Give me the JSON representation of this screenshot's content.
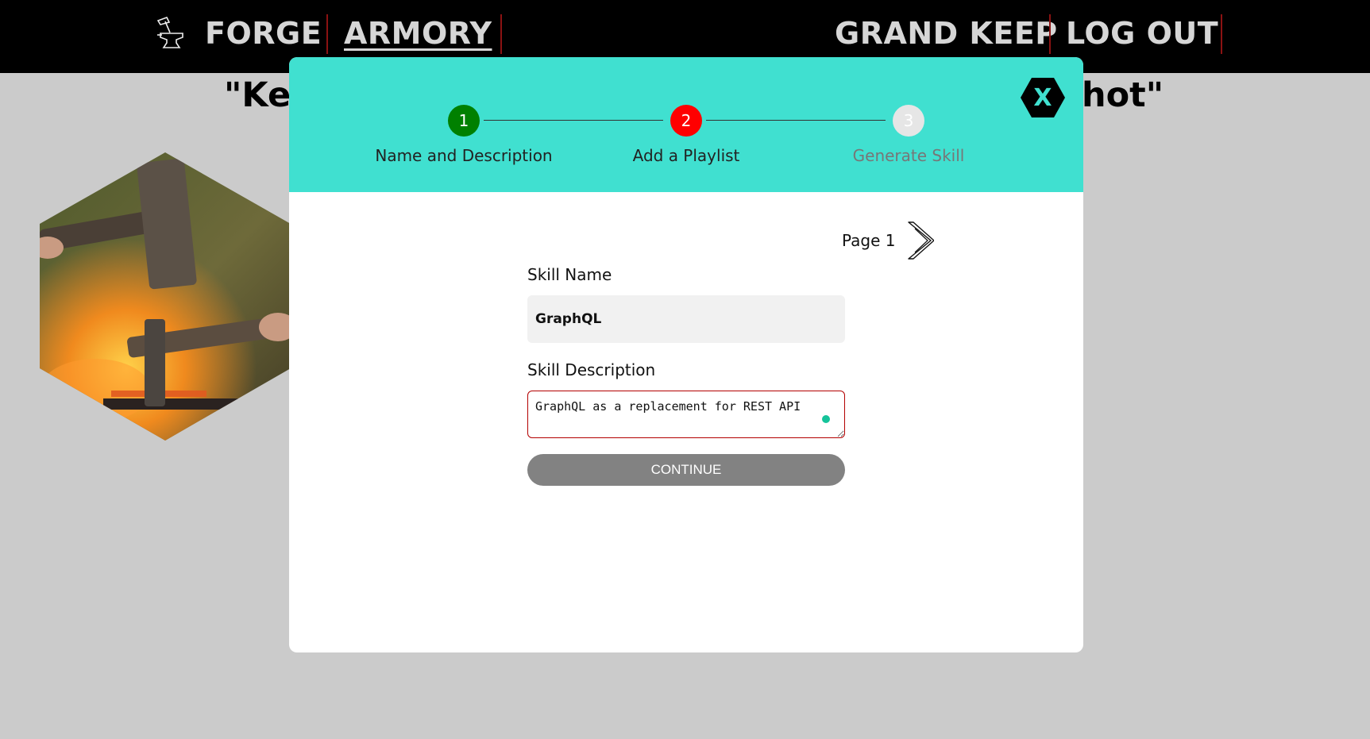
{
  "navbar": {
    "links": [
      {
        "label": "FORGE"
      },
      {
        "label": "ARMORY"
      },
      {
        "label": "GRAND KEEP"
      },
      {
        "label": "LOG OUT"
      }
    ],
    "active": "ARMORY"
  },
  "background": {
    "quote_left": "\"Kee",
    "quote_right": "hot\""
  },
  "modal": {
    "steps": [
      {
        "number": "1",
        "label": "Name and Description",
        "color": "#008000",
        "state": "completed"
      },
      {
        "number": "2",
        "label": "Add a Playlist",
        "color": "#ff0000",
        "state": "current"
      },
      {
        "number": "3",
        "label": "Generate Skill",
        "color": "#e6e6e6",
        "state": "pending"
      }
    ],
    "header_color": "#40e0d0",
    "close_label": "X",
    "page_label": "Page 1",
    "form": {
      "name_label": "Skill Name",
      "name_value": "GraphQL",
      "description_label": "Skill Description",
      "description_value": "GraphQL as a replacement for REST API",
      "continue_label": "CONTINUE"
    }
  },
  "icons": {
    "logo": "anvil-hammer-icon",
    "close": "close-hexagon-icon",
    "next": "chevron-right-icon"
  }
}
